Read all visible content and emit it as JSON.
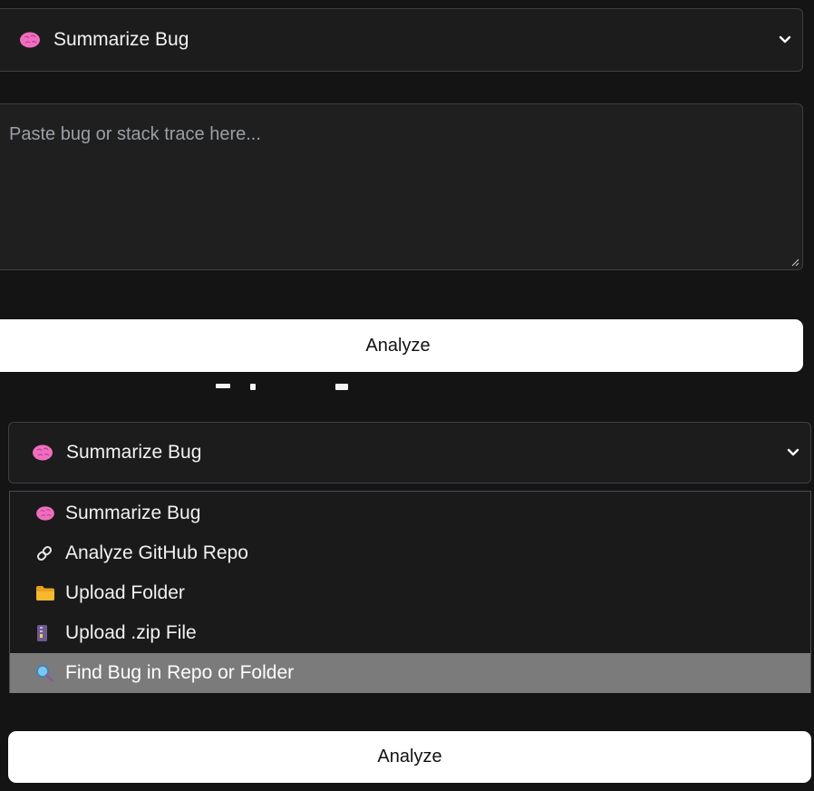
{
  "top_form": {
    "mode_select": {
      "icon": "brain-icon",
      "value": "Summarize Bug"
    },
    "bug_input": {
      "placeholder": "Paste bug or stack trace here..."
    },
    "analyze_label": "Analyze"
  },
  "bottom_form": {
    "mode_select": {
      "icon": "brain-icon",
      "value": "Summarize Bug"
    },
    "options": [
      {
        "icon": "brain-icon",
        "label": "Summarize Bug"
      },
      {
        "icon": "link-icon",
        "label": "Analyze GitHub Repo"
      },
      {
        "icon": "folder-icon",
        "label": "Upload Folder"
      },
      {
        "icon": "zip-file-icon",
        "label": "Upload .zip File"
      },
      {
        "icon": "magnifier-icon",
        "label": "Find Bug in Repo or Folder"
      }
    ],
    "highlighted_option": "Find Bug in Repo or Folder",
    "analyze_label": "Analyze"
  },
  "colors": {
    "background": "#141414",
    "field_border": "#3b3f45",
    "button_bg": "#ffffff",
    "highlight": "#7b7b7b",
    "brain_pink": "#f06ec0",
    "folder_yellow": "#f5b82e"
  }
}
